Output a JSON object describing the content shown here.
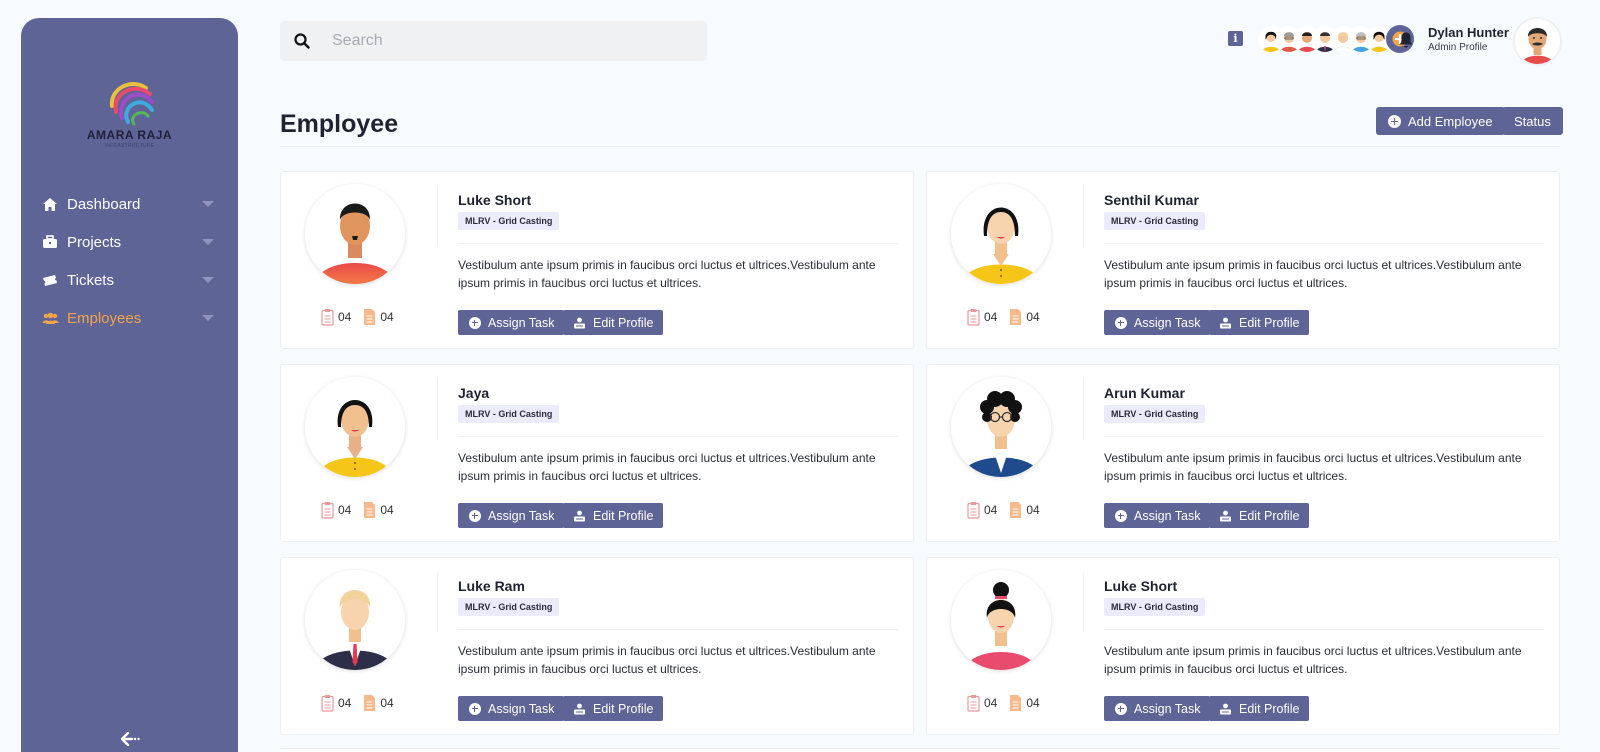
{
  "brand": {
    "name": "AMARA RAJA",
    "tagline": "INFRASTRUCTURE"
  },
  "sidebar": {
    "items": [
      {
        "label": "Dashboard",
        "icon": "home-icon",
        "active": false
      },
      {
        "label": "Projects",
        "icon": "briefcase-icon",
        "active": false
      },
      {
        "label": "Tickets",
        "icon": "ticket-icon",
        "active": false
      },
      {
        "label": "Employees",
        "icon": "users-icon",
        "active": true
      }
    ],
    "collapse_icon": "arrow-left-icon"
  },
  "search": {
    "placeholder": "Search",
    "value": ""
  },
  "header": {
    "user_name": "Dylan Hunter",
    "user_role": "Admin Profile"
  },
  "page": {
    "title": "Employee",
    "add_label": "Add Employee",
    "status_label": "Status"
  },
  "card_actions": {
    "assign": "Assign Task",
    "edit": "Edit Profile"
  },
  "employees": [
    {
      "name": "Luke Short",
      "dept": "MLRV - Grid Casting",
      "desc": "Vestibulum ante ipsum primis in faucibus orci luctus et ultrices.Vestibulum ante ipsum primis in faucibus orci luctus et ultrices.",
      "tasks": "04",
      "docs": "04"
    },
    {
      "name": "Senthil Kumar",
      "dept": "MLRV - Grid Casting",
      "desc": "Vestibulum ante ipsum primis in faucibus orci luctus et ultrices.Vestibulum ante ipsum primis in faucibus orci luctus et ultrices.",
      "tasks": "04",
      "docs": "04"
    },
    {
      "name": "Jaya",
      "dept": "MLRV - Grid Casting",
      "desc": "Vestibulum ante ipsum primis in faucibus orci luctus et ultrices.Vestibulum ante ipsum primis in faucibus orci luctus et ultrices.",
      "tasks": "04",
      "docs": "04"
    },
    {
      "name": "Arun Kumar",
      "dept": "MLRV - Grid Casting",
      "desc": "Vestibulum ante ipsum primis in faucibus orci luctus et ultrices.Vestibulum ante ipsum primis in faucibus orci luctus et ultrices.",
      "tasks": "04",
      "docs": "04"
    },
    {
      "name": "Luke Ram",
      "dept": "MLRV - Grid Casting",
      "desc": "Vestibulum ante ipsum primis in faucibus orci luctus et ultrices.Vestibulum ante ipsum primis in faucibus orci luctus et ultrices.",
      "tasks": "04",
      "docs": "04"
    },
    {
      "name": "Luke Short",
      "dept": "MLRV - Grid Casting",
      "desc": "Vestibulum ante ipsum primis in faucibus orci luctus et ultrices.Vestibulum ante ipsum primis in faucibus orci luctus et ultrices.",
      "tasks": "04",
      "docs": "04"
    }
  ],
  "colors": {
    "sidebar": "#5f6496",
    "accent": "#f3a44a",
    "button": "#5f6496",
    "dept_badge": "#ecebfb",
    "page_bg": "#f7fbfd"
  }
}
